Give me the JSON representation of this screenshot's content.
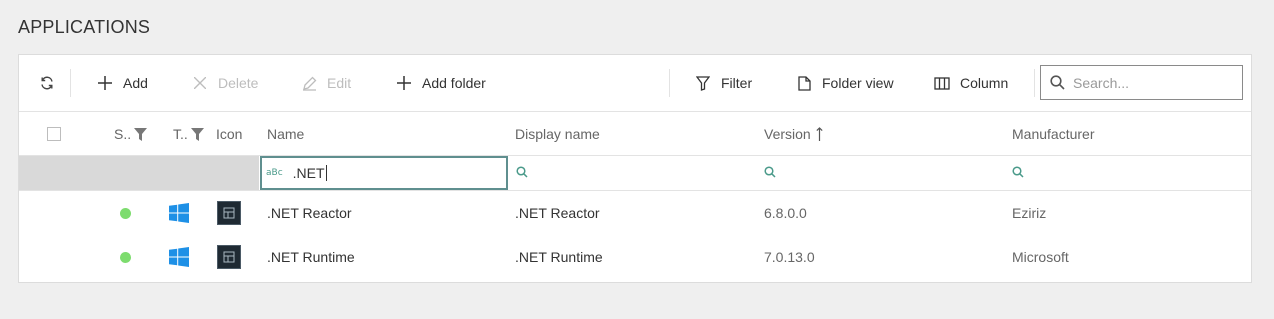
{
  "page": {
    "title": "APPLICATIONS"
  },
  "toolbar": {
    "refresh_icon": "refresh-icon",
    "add_label": "Add",
    "delete_label": "Delete",
    "edit_label": "Edit",
    "add_folder_label": "Add folder",
    "filter_label": "Filter",
    "folder_view_label": "Folder view",
    "column_label": "Column",
    "search_placeholder": "Search..."
  },
  "table": {
    "columns": {
      "status": "S..",
      "type": "T..",
      "icon": "Icon",
      "name": "Name",
      "display_name": "Display name",
      "version": "Version",
      "manufacturer": "Manufacturer"
    },
    "sort": {
      "column": "version",
      "direction": "ascending"
    },
    "filters": {
      "name": ".NET"
    },
    "rows": [
      {
        "status": "active",
        "type": "windows",
        "name": ".NET Reactor",
        "display_name": ".NET Reactor",
        "version": "6.8.0.0",
        "manufacturer": "Eziriz"
      },
      {
        "status": "active",
        "type": "windows",
        "name": ".NET Runtime",
        "display_name": ".NET Runtime",
        "version": "7.0.13.0",
        "manufacturer": "Microsoft"
      }
    ]
  },
  "colors": {
    "status_active": "#7ddc6e",
    "windows_blue": "#1e90e6",
    "filter_border": "#5f8f8f"
  }
}
